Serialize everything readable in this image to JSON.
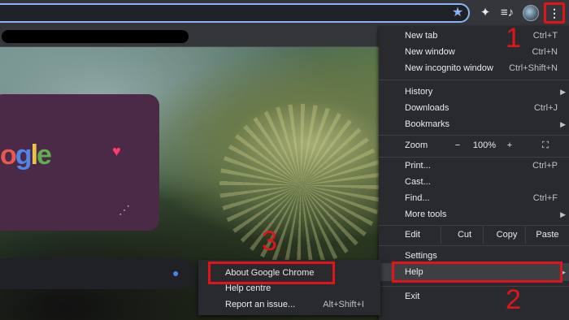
{
  "toolbar": {
    "icons": [
      "star-icon",
      "extensions-icon",
      "reading-list-icon",
      "profile-avatar",
      "more-menu-icon"
    ]
  },
  "menu": {
    "new_tab": {
      "label": "New tab",
      "shortcut": "Ctrl+T"
    },
    "new_window": {
      "label": "New window",
      "shortcut": "Ctrl+N"
    },
    "new_incognito": {
      "label": "New incognito window",
      "shortcut": "Ctrl+Shift+N"
    },
    "history": {
      "label": "History"
    },
    "downloads": {
      "label": "Downloads",
      "shortcut": "Ctrl+J"
    },
    "bookmarks": {
      "label": "Bookmarks"
    },
    "zoom": {
      "label": "Zoom",
      "minus": "−",
      "value": "100%",
      "plus": "+"
    },
    "print": {
      "label": "Print...",
      "shortcut": "Ctrl+P"
    },
    "cast": {
      "label": "Cast..."
    },
    "find": {
      "label": "Find...",
      "shortcut": "Ctrl+F"
    },
    "more_tools": {
      "label": "More tools"
    },
    "edit": {
      "label": "Edit",
      "cut": "Cut",
      "copy": "Copy",
      "paste": "Paste"
    },
    "settings": {
      "label": "Settings"
    },
    "help": {
      "label": "Help"
    },
    "exit": {
      "label": "Exit"
    }
  },
  "help_submenu": {
    "about": {
      "label": "About Google Chrome"
    },
    "help_centre": {
      "label": "Help centre"
    },
    "report": {
      "label": "Report an issue...",
      "shortcut": "Alt+Shift+I"
    }
  },
  "steps": {
    "one": "1",
    "two": "2",
    "three": "3"
  },
  "colors": {
    "annotation_red": "#e0141b",
    "accent_blue": "#8ab4f8",
    "menu_bg": "#292a2d"
  }
}
